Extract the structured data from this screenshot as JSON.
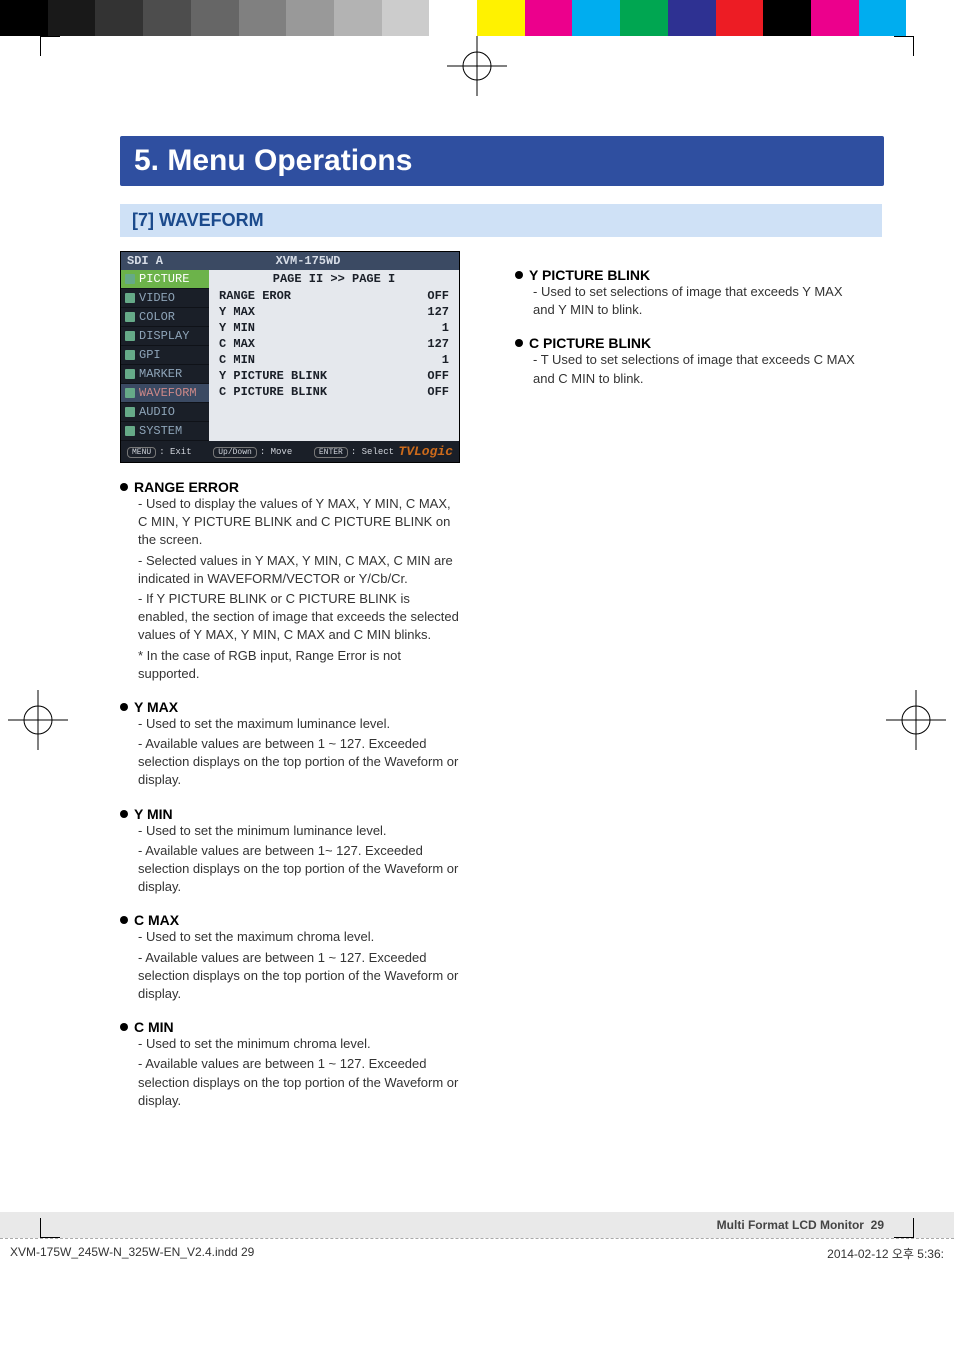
{
  "colorbar": [
    "#000",
    "#191919",
    "#333",
    "#4d4d4d",
    "#666",
    "#808080",
    "#999",
    "#b3b3b3",
    "#ccc",
    "#fff",
    "#fff200",
    "#ec008c",
    "#00adef",
    "#00a651",
    "#2e3192",
    "#ed1c24",
    "#000",
    "#ec008c",
    "#00adef",
    "#fff"
  ],
  "header": {
    "title": "5. Menu Operations"
  },
  "subheader": {
    "title": "[7] WAVEFORM"
  },
  "osd": {
    "title_left": "SDI A",
    "title_right": "XVM-175WD",
    "sidebar": [
      "PICTURE",
      "VIDEO",
      "COLOR",
      "DISPLAY",
      "GPI",
      "MARKER",
      "WAVEFORM",
      "AUDIO",
      "SYSTEM"
    ],
    "page_label": "PAGE II >> PAGE I",
    "rows": [
      {
        "k": "RANGE EROR",
        "v": "OFF"
      },
      {
        "k": " Y MAX",
        "v": "127"
      },
      {
        "k": " Y MIN",
        "v": "1"
      },
      {
        "k": " C MAX",
        "v": "127"
      },
      {
        "k": " C MIN",
        "v": "1"
      },
      {
        "k": " Y PICTURE BLINK",
        "v": "OFF"
      },
      {
        "k": " C PICTURE BLINK",
        "v": "OFF"
      }
    ],
    "footer": {
      "menu": "MENU",
      "menu_l": ": Exit",
      "ud": "Up/Down",
      "ud_l": ": Move",
      "ent": "ENTER",
      "ent_l": ": Select",
      "brand": "TVLogic"
    }
  },
  "left_items": [
    {
      "title": "RANGE  ERROR",
      "paras": [
        "- Used to display the values of Y MAX, Y MIN, C MAX, C MIN, Y PICTURE BLINK and C PICTURE BLINK on the screen.",
        "- Selected values in Y MAX, Y MIN, C MAX, C MIN are indicated in WAVEFORM/VECTOR or Y/Cb/Cr.",
        "- If Y PICTURE BLINK or C PICTURE BLINK is enabled, the section of image that exceeds the selected values of Y MAX, Y MIN, C MAX and C MIN blinks.",
        "* In the case of RGB input, Range Error is not supported."
      ]
    },
    {
      "title": "Y MAX",
      "paras": [
        "- Used to set the maximum luminance level.",
        "- Available values are between 1 ~ 127. Exceeded selection displays on the top portion of the   Waveform or display."
      ]
    },
    {
      "title": "Y MIN",
      "paras": [
        "- Used to set the minimum luminance level.",
        "- Available values are between 1~ 127. Exceeded selection displays on the top portion of the Waveform or display."
      ]
    },
    {
      "title": "C MAX",
      "paras": [
        "- Used to set the maximum chroma level.",
        "- Available values are between 1 ~ 127. Exceeded selection displays on the top portion of the Waveform or display."
      ]
    },
    {
      "title": "C MIN",
      "paras": [
        "- Used to set the minimum chroma level.",
        "- Available values are between 1 ~ 127. Exceeded selection displays on the top portion of the Waveform or display."
      ]
    }
  ],
  "right_items": [
    {
      "title": "Y PICTURE BLINK",
      "paras": [
        "- Used to set selections of image that exceeds Y MAX and Y MIN to blink."
      ]
    },
    {
      "title": "C PICTURE BLINK",
      "paras": [
        "- T Used to set selections of image that exceeds C MAX and C MIN to blink."
      ]
    }
  ],
  "footer": {
    "label": "Multi Format LCD Monitor",
    "page": "29"
  },
  "printinfo": {
    "file": "XVM-175W_245W-N_325W-EN_V2.4.indd   29",
    "date": "2014-02-12   오후 5:36:"
  }
}
